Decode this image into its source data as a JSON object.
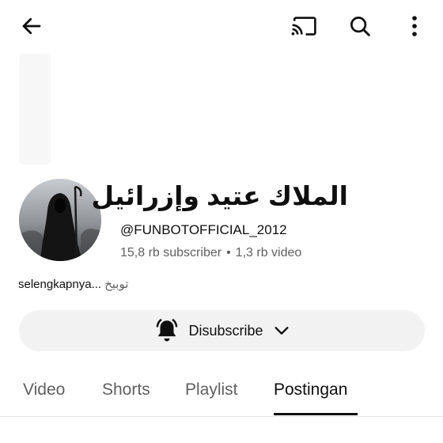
{
  "topbar": {
    "back_icon": "arrow-left-icon",
    "cast_icon": "cast-icon",
    "search_icon": "search-icon",
    "more_icon": "more-vertical-icon"
  },
  "channel": {
    "name": "الملاك عتيد وإزرائيل",
    "handle": "@FUNBOTOFFICIAL_2012",
    "subscribers": "15,8 rb subscriber",
    "separator": "•",
    "videos": "1,3 rb video",
    "description_more": "selengkapnya...",
    "description_text": "توبيخ"
  },
  "subscribe": {
    "label": "Disubscribe",
    "bell_icon": "bell-icon",
    "chevron_icon": "chevron-down-icon"
  },
  "tabs": [
    {
      "label": "Video",
      "active": false
    },
    {
      "label": "Shorts",
      "active": false
    },
    {
      "label": "Playlist",
      "active": false
    },
    {
      "label": "Postingan",
      "active": true
    }
  ],
  "colors": {
    "text_primary": "#0f0f0f",
    "text_secondary": "#606060",
    "button_bg": "#f2f2f2",
    "divider": "#e5e5e5"
  }
}
